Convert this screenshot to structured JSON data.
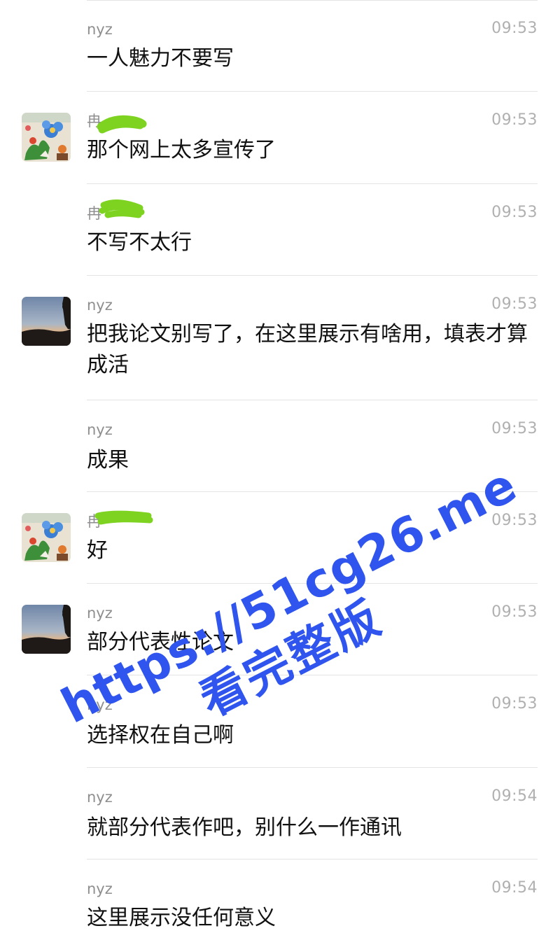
{
  "messages": [
    {
      "sender": "nyz",
      "time": "09:53",
      "text": "一人魅力不要写",
      "avatar": "none"
    },
    {
      "sender": "冉",
      "time": "09:53",
      "text": "那个网上太多宣传了",
      "avatar": "flower-painting"
    },
    {
      "sender": "冉",
      "time": "09:53",
      "text": "不写不太行",
      "avatar": "none"
    },
    {
      "sender": "nyz",
      "time": "09:53",
      "text": "把我论文别写了，在这里展示有啥用，填表才算成活",
      "avatar": "sunset"
    },
    {
      "sender": "nyz",
      "time": "09:53",
      "text": "成果",
      "avatar": "none"
    },
    {
      "sender": "冉",
      "time": "09:53",
      "text": "好",
      "avatar": "flower-painting"
    },
    {
      "sender": "nyz",
      "time": "09:53",
      "text": "部分代表性论文",
      "avatar": "sunset"
    },
    {
      "sender": "nyz",
      "time": "09:53",
      "text": "选择权在自己啊",
      "avatar": "none"
    },
    {
      "sender": "nyz",
      "time": "09:54",
      "text": "就部分代表作吧，别什么一作通讯",
      "avatar": "none"
    },
    {
      "sender": "nyz",
      "time": "09:54",
      "text": "这里展示没任何意义",
      "avatar": "none"
    }
  ],
  "watermark": {
    "line1": "https://51cg26.me",
    "line2": "看完整版",
    "color": "#2f55ee"
  },
  "colors": {
    "redaction": "#7ed321",
    "time": "#b0b0b0",
    "sender": "#8e8e8e"
  }
}
